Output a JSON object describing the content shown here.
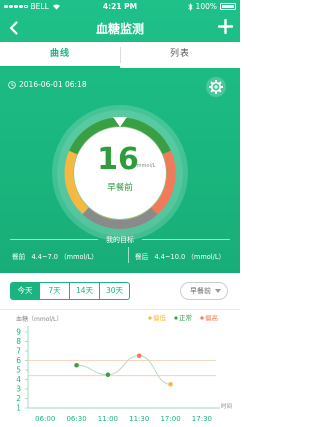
{
  "status_bar": {
    "carrier": "BELL",
    "time": "4:21 PM",
    "battery": "100%"
  },
  "nav": {
    "title": "血糖监测"
  },
  "tabs": [
    {
      "label": "曲线"
    },
    {
      "label": "列表"
    }
  ],
  "record": {
    "datetime": "2016-06-01 06:18"
  },
  "gauge": {
    "value": "16",
    "unit": "mmol/L",
    "period": "早餐前"
  },
  "goal": {
    "title": "我的目标",
    "before_meal": {
      "label": "餐前",
      "range": "4.4~7.0",
      "unit": "（mmol/L）"
    },
    "after_meal": {
      "label": "餐后",
      "range": "4.4~10.0",
      "unit": "（mmol/L）"
    }
  },
  "filters": {
    "ranges": [
      "今天",
      "7天",
      "14天",
      "30天"
    ],
    "selected": "今天",
    "meal_select": "早餐前"
  },
  "colors": {
    "green": "#1ab57e",
    "low": "#f5b942",
    "normal": "#3a9f44",
    "high": "#f07a5a"
  },
  "chart_data": {
    "type": "line",
    "ylabel": "血糖（mmol/L）",
    "xlabel": "时间",
    "x": [
      "06:00",
      "06:30",
      "11:00",
      "11:30",
      "17:00",
      "17:30"
    ],
    "yticks": [
      1,
      2,
      3,
      4,
      5,
      6,
      7,
      8,
      9
    ],
    "ylim": [
      1,
      9
    ],
    "legend": [
      "偏低",
      "正常",
      "偏高"
    ],
    "legend_placement": "top-right",
    "reference_lines": [
      4.4,
      6.0
    ],
    "points": [
      {
        "x": "06:30",
        "y": 5.5,
        "status": "正常"
      },
      {
        "x": "11:00",
        "y": 4.5,
        "status": "正常"
      },
      {
        "x": "11:30",
        "y": 6.5,
        "status": "偏高"
      },
      {
        "x": "17:00",
        "y": 3.5,
        "status": "偏低"
      }
    ]
  }
}
